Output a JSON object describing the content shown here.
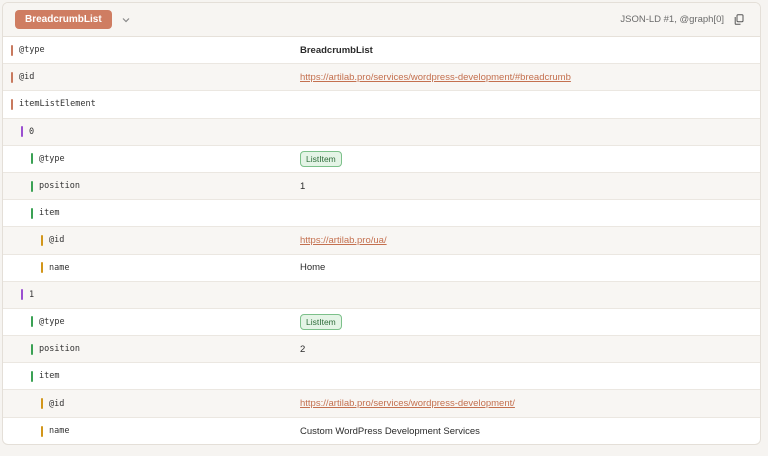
{
  "header": {
    "type_label": "BreadcrumbList",
    "source_label": "JSON-LD #1, @graph[0]"
  },
  "colors": {
    "level0": "#c8795e",
    "level1": "#9a4fd0",
    "level2": "#3aa154",
    "level3": "#d2961a",
    "link": "#c4704f",
    "badge": "#cf7d62"
  },
  "rows": [
    {
      "key": "@type",
      "value": "BreadcrumbList",
      "kind": "bold",
      "level": 0
    },
    {
      "key": "@id",
      "value": "https://artilab.pro/services/wordpress-development/#breadcrumb",
      "kind": "link",
      "level": 0
    },
    {
      "key": "itemListElement",
      "value": "",
      "kind": "none",
      "level": 0
    },
    {
      "key": "0",
      "value": "",
      "kind": "none",
      "level": 1
    },
    {
      "key": "@type",
      "value": "ListItem",
      "kind": "pill",
      "level": 2
    },
    {
      "key": "position",
      "value": "1",
      "kind": "text",
      "level": 2
    },
    {
      "key": "item",
      "value": "",
      "kind": "none",
      "level": 2
    },
    {
      "key": "@id",
      "value": "https://artilab.pro/ua/",
      "kind": "link",
      "level": 3
    },
    {
      "key": "name",
      "value": "Home",
      "kind": "text",
      "level": 3
    },
    {
      "key": "1",
      "value": "",
      "kind": "none",
      "level": 1
    },
    {
      "key": "@type",
      "value": "ListItem",
      "kind": "pill",
      "level": 2
    },
    {
      "key": "position",
      "value": "2",
      "kind": "text",
      "level": 2
    },
    {
      "key": "item",
      "value": "",
      "kind": "none",
      "level": 2
    },
    {
      "key": "@id",
      "value": "https://artilab.pro/services/wordpress-development/",
      "kind": "link",
      "level": 3
    },
    {
      "key": "name",
      "value": "Custom WordPress Development Services",
      "kind": "text",
      "level": 3
    }
  ]
}
